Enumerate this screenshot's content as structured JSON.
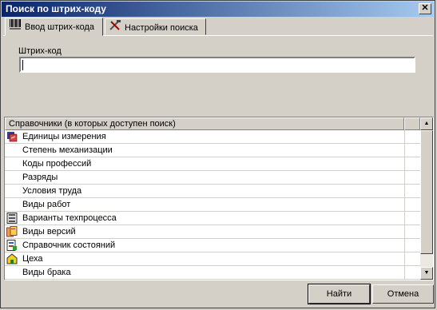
{
  "window": {
    "title": "Поиск по штрих-коду",
    "close_glyph": "✕"
  },
  "tabs": [
    {
      "label": "Ввод штрих-кода",
      "icon": "barcode-icon",
      "active": true
    },
    {
      "label": "Настройки поиска",
      "icon": "tools-icon",
      "active": false
    }
  ],
  "barcode": {
    "label": "Штрих-код",
    "value": ""
  },
  "directories": {
    "header": "Справочники (в которых доступен поиск)",
    "items": [
      {
        "label": "Единицы измерения",
        "icon": "units-icon"
      },
      {
        "label": "Степень механизации",
        "icon": ""
      },
      {
        "label": "Коды профессий",
        "icon": ""
      },
      {
        "label": "Разряды",
        "icon": ""
      },
      {
        "label": "Условия труда",
        "icon": ""
      },
      {
        "label": "Виды работ",
        "icon": ""
      },
      {
        "label": "Варианты техпроцесса",
        "icon": "process-icon"
      },
      {
        "label": "Виды версий",
        "icon": "versions-icon"
      },
      {
        "label": "Справочник состояний",
        "icon": "states-icon"
      },
      {
        "label": "Цеха",
        "icon": "workshop-icon"
      },
      {
        "label": "Виды брака",
        "icon": ""
      }
    ]
  },
  "buttons": {
    "find": "Найти",
    "cancel": "Отмена"
  },
  "colors": {
    "titlebar_start": "#0a246a",
    "titlebar_end": "#a6caf0",
    "face": "#d4d0c8"
  }
}
